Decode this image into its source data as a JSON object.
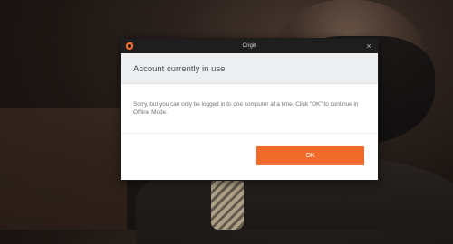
{
  "window": {
    "title": "Origin",
    "close_glyph": "×",
    "logo_icon": "origin-logo-icon",
    "close_icon": "close-icon"
  },
  "dialog": {
    "heading": "Account currently in use",
    "message": "Sorry, but you can only be logged in to one computer at a time. Click \"OK\" to continue in Offline Mode.",
    "ok_label": "OK"
  },
  "colors": {
    "accent": "#f06b2a",
    "titlebar": "#1e1e1e",
    "header_bg": "#eceeef",
    "heading_text": "#4a4f54",
    "body_text": "#6f747a"
  }
}
